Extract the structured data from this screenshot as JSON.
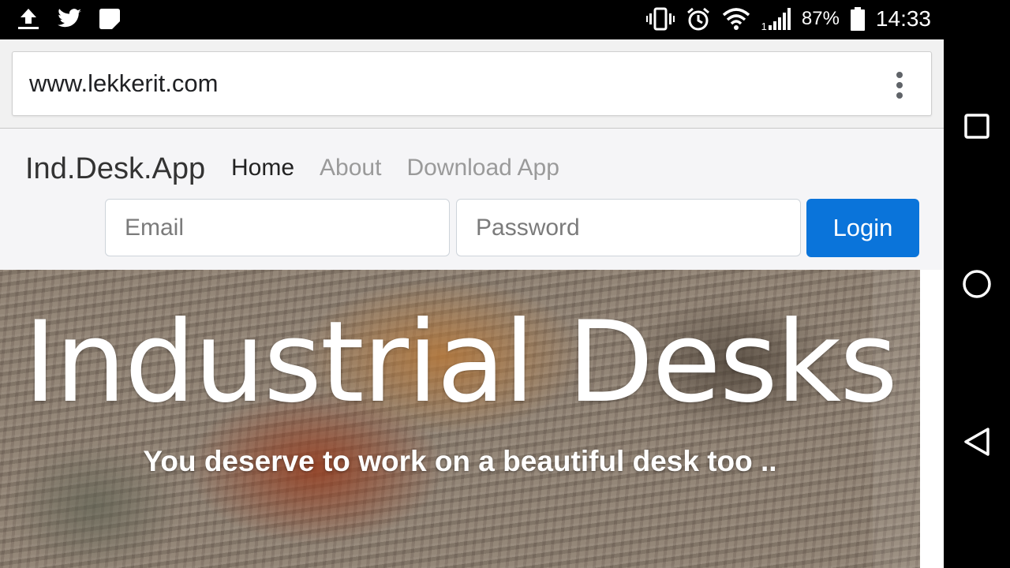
{
  "status_bar": {
    "icons_left": [
      "upload-icon",
      "twitter-icon",
      "notification-icon"
    ],
    "icons_right": [
      "vibrate-icon",
      "alarm-icon",
      "wifi-icon",
      "signal-icon",
      "battery-icon"
    ],
    "signal_sim": "1",
    "battery_percent": "87%",
    "time": "14:33"
  },
  "browser": {
    "url": "www.lekkerit.com",
    "menu_icon": "more-vert-icon"
  },
  "navbar": {
    "brand": "Ind.Desk.App",
    "links": [
      {
        "label": "Home",
        "active": true
      },
      {
        "label": "About",
        "active": false
      },
      {
        "label": "Download App",
        "active": false
      }
    ],
    "email_placeholder": "Email",
    "password_placeholder": "Password",
    "login_label": "Login"
  },
  "hero": {
    "title": "Industrial Desks",
    "subtitle": "You deserve to work on a beautiful desk too .."
  },
  "system_nav": {
    "buttons": [
      "recent-apps-icon",
      "home-icon",
      "back-icon"
    ]
  },
  "colors": {
    "primary": "#0a74da",
    "navbar_bg": "#f5f5f7",
    "muted_link": "#9a9a9a"
  }
}
